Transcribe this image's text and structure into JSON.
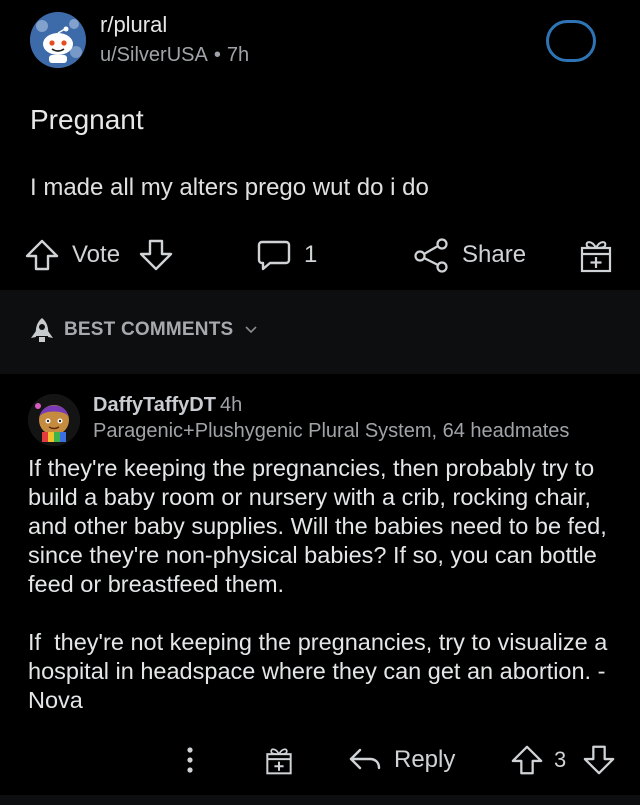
{
  "post": {
    "subreddit": "r/plural",
    "author": "u/SilverUSA",
    "separator": "•",
    "age": "7h",
    "title": "Pregnant",
    "body": "I made all my alters prego wut do i do"
  },
  "actions": {
    "vote_label": "Vote",
    "comment_count": "1",
    "share_label": "Share"
  },
  "sort": {
    "label": "BEST COMMENTS"
  },
  "comment": {
    "username": "DaffyTaffyDT",
    "age": "4h",
    "flair": "Paragenic+Plushygenic Plural System, 64 headmates",
    "paragraph1": "If they're keeping the pregnancies, then probably try to build a baby room or nursery with a crib, rocking chair, and other baby supplies. Will the babies need to be fed, since they're non-physical babies? If so, you can bottle feed or breastfeed them.",
    "paragraph2": "If  they're not keeping the pregnancies, try to visualize a hospital in headspace where they can get an abortion. - Nova",
    "reply_label": "Reply",
    "score": "3"
  },
  "icons": {
    "subreddit_avatar": "reddit-snoo-icon",
    "vote_up": "arrow-up-icon",
    "vote_down": "arrow-down-icon",
    "comment": "comment-bubble-icon",
    "share": "share-icon",
    "award": "award-gift-icon",
    "sort": "rocket-icon",
    "more": "more-vertical-icon",
    "reply": "reply-arrow-icon"
  },
  "colors": {
    "background": "#000000",
    "text": "#e4e6e8",
    "muted": "#a0a4a8",
    "accent_ring": "#2e74b5"
  }
}
